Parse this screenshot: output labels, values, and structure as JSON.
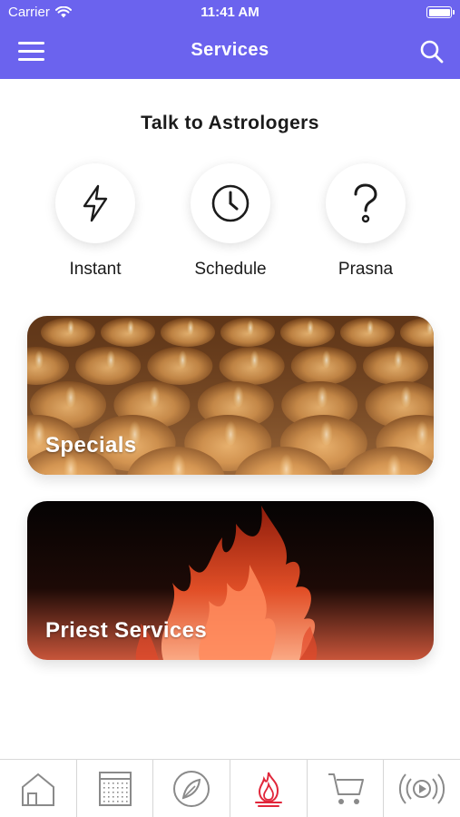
{
  "status_bar": {
    "carrier": "Carrier",
    "time": "11:41 AM"
  },
  "header": {
    "title": "Services"
  },
  "talk": {
    "title": "Talk to Astrologers",
    "options": [
      {
        "label": "Instant",
        "icon": "lightning-icon"
      },
      {
        "label": "Schedule",
        "icon": "clock-icon"
      },
      {
        "label": "Prasna",
        "icon": "question-icon"
      }
    ]
  },
  "cards": [
    {
      "label": "Specials",
      "image": "oil-lamps-image"
    },
    {
      "label": "Priest Services",
      "image": "fire-image"
    }
  ],
  "tabbar": {
    "items": [
      {
        "name": "home",
        "icon": "home-icon"
      },
      {
        "name": "calendar",
        "icon": "calendar-icon"
      },
      {
        "name": "explore",
        "icon": "compass-leaf-icon"
      },
      {
        "name": "services",
        "icon": "fire-icon",
        "active": true
      },
      {
        "name": "cart",
        "icon": "cart-icon"
      },
      {
        "name": "live",
        "icon": "broadcast-play-icon"
      }
    ]
  },
  "colors": {
    "header_bg": "#6b63ee",
    "active_tab": "#e1263a",
    "inactive_tab": "#8a8a8a"
  }
}
